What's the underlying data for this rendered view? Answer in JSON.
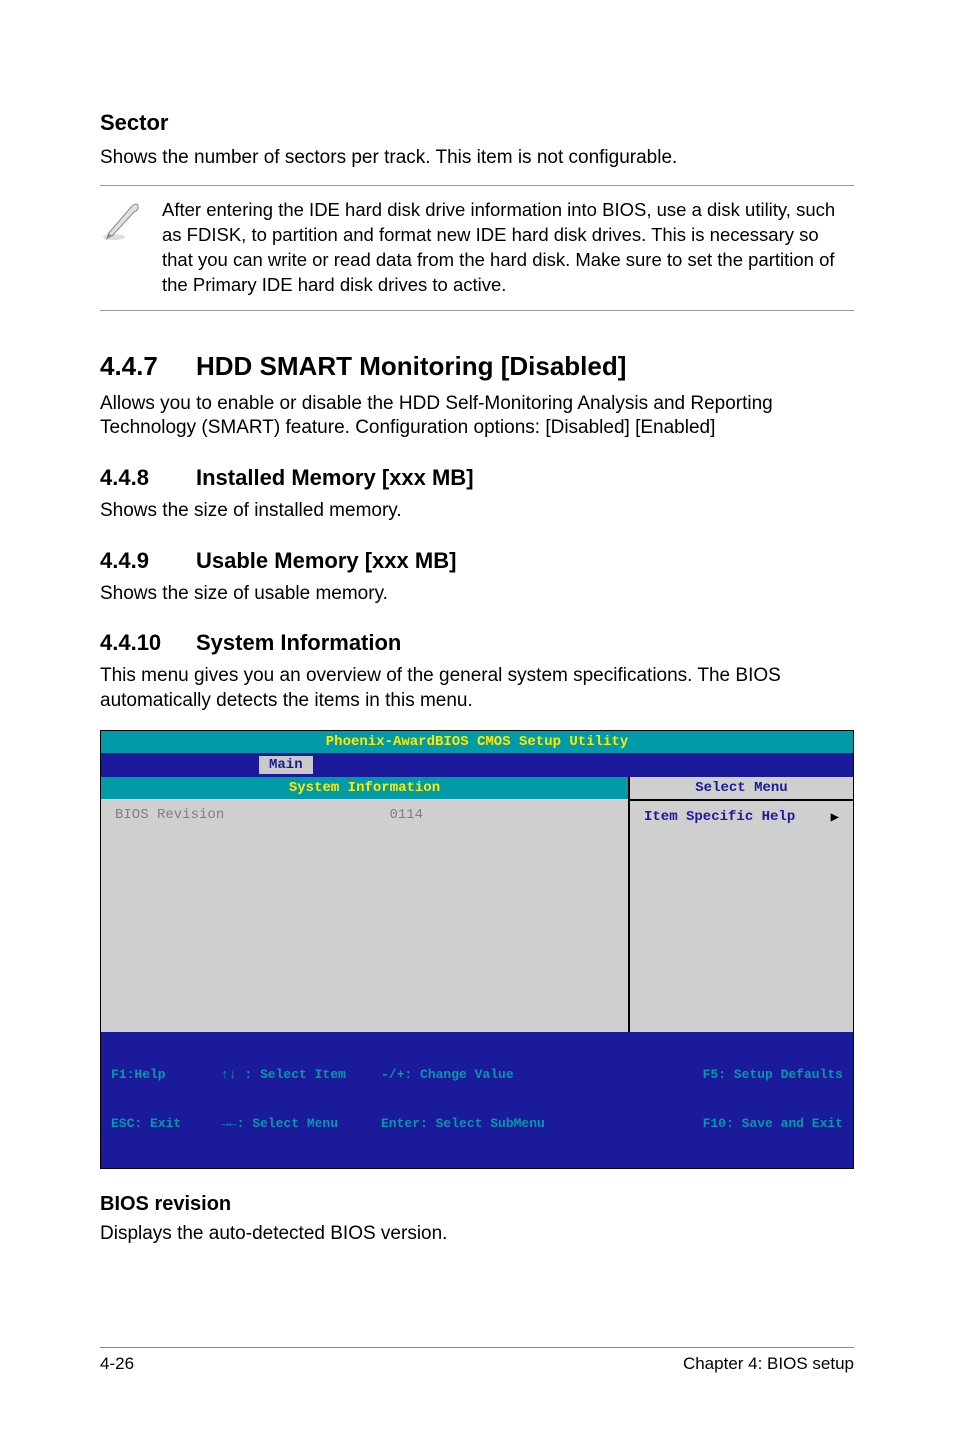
{
  "sector": {
    "heading": "Sector",
    "body": "Shows the number of sectors per track. This item is not configurable."
  },
  "note": {
    "text": "After entering the IDE hard disk drive information into BIOS, use a disk utility, such as FDISK, to partition and format new IDE hard disk drives. This is necessary so that you can write or read data from the hard disk. Make sure to set the partition of the Primary IDE hard disk drives to active."
  },
  "s447": {
    "num": "4.4.7",
    "title": "HDD SMART Monitoring [Disabled]",
    "body": "Allows you to enable or disable the HDD Self-Monitoring Analysis and Reporting Technology (SMART) feature. Configuration options: [Disabled] [Enabled]"
  },
  "s448": {
    "num": "4.4.8",
    "title": "Installed Memory [xxx MB]",
    "body": "Shows the size of installed memory."
  },
  "s449": {
    "num": "4.4.9",
    "title": "Usable Memory [xxx MB]",
    "body": "Shows the size of usable memory."
  },
  "s4410": {
    "num": "4.4.10",
    "title": "System Information",
    "body": "This menu gives you an overview of the general system specifications. The BIOS automatically detects the items in this menu."
  },
  "bios": {
    "title": "Phoenix-AwardBIOS CMOS Setup Utility",
    "tab": "Main",
    "left_header": "System Information",
    "right_header": "Select Menu",
    "item_label": "BIOS Revision",
    "item_value": "0114",
    "help_label": "Item Specific Help",
    "footer": {
      "c1a": "F1:Help",
      "c1b": "ESC: Exit",
      "c2a": "↑↓ : Select Item",
      "c2b": "→←: Select Menu",
      "c3a": "-/+: Change Value",
      "c3b": "Enter: Select SubMenu",
      "c4a": "F5: Setup Defaults",
      "c4b": "F10: Save and Exit"
    }
  },
  "biosrev": {
    "heading": "BIOS revision",
    "body": "Displays the auto-detected BIOS version."
  },
  "footer": {
    "left": "4-26",
    "right": "Chapter 4: BIOS setup"
  }
}
